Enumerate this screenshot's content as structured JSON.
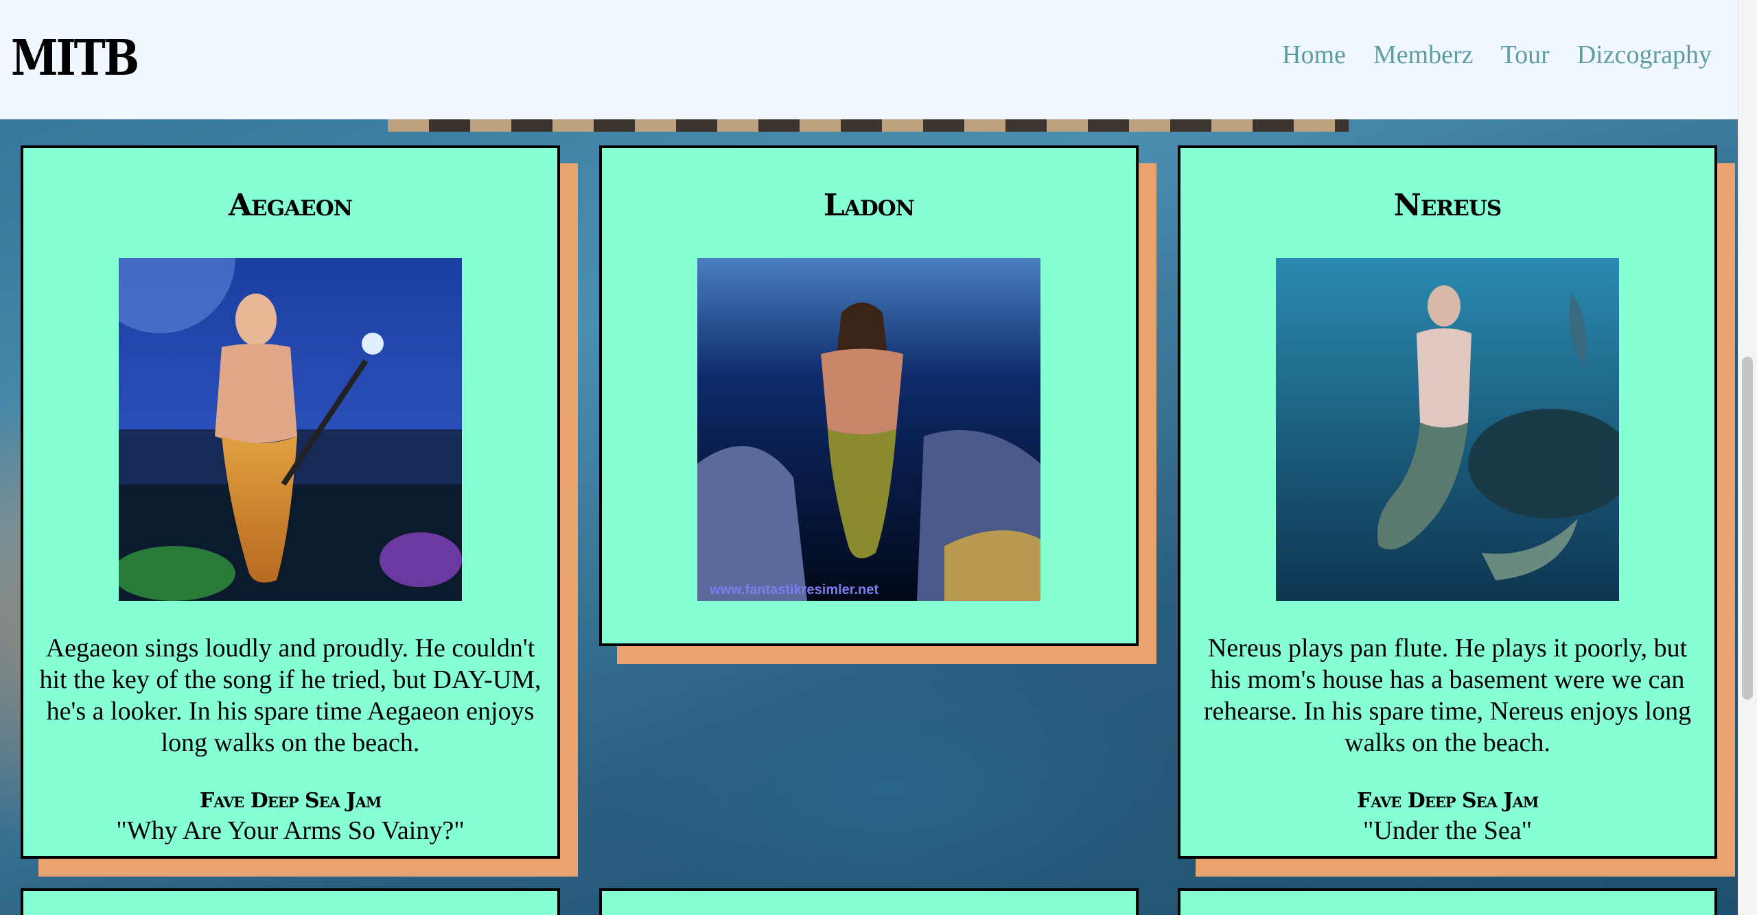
{
  "header": {
    "logo": "MITB",
    "nav": [
      "Home",
      "Memberz",
      "Tour",
      "Dizcography"
    ]
  },
  "members": [
    {
      "name": "Aegaeon",
      "bio": "Aegaeon sings loudly and proudly. He couldn't hit the key of the song if he tried, but DAY-UM, he's a looker. In his spare time Aegaeon enjoys long walks on the beach.",
      "jam_label": "Fave Deep Sea Jam",
      "jam": "\"Why Are Your Arms So Vainy?\""
    },
    {
      "name": "Ladon",
      "watermark": "www.fantastikresimler.net"
    },
    {
      "name": "Nereus",
      "bio": "Nereus plays pan flute. He plays it poorly, but his mom's house has a basement were we can rehearse. In his spare time, Nereus enjoys long walks on the beach.",
      "jam_label": "Fave Deep Sea Jam",
      "jam": "\"Under the Sea\""
    }
  ],
  "colors": {
    "card": "#86ffd5",
    "card_shadow": "#e8a36e",
    "header": "#f0f7ff",
    "nav_link": "#5f9ea0"
  }
}
